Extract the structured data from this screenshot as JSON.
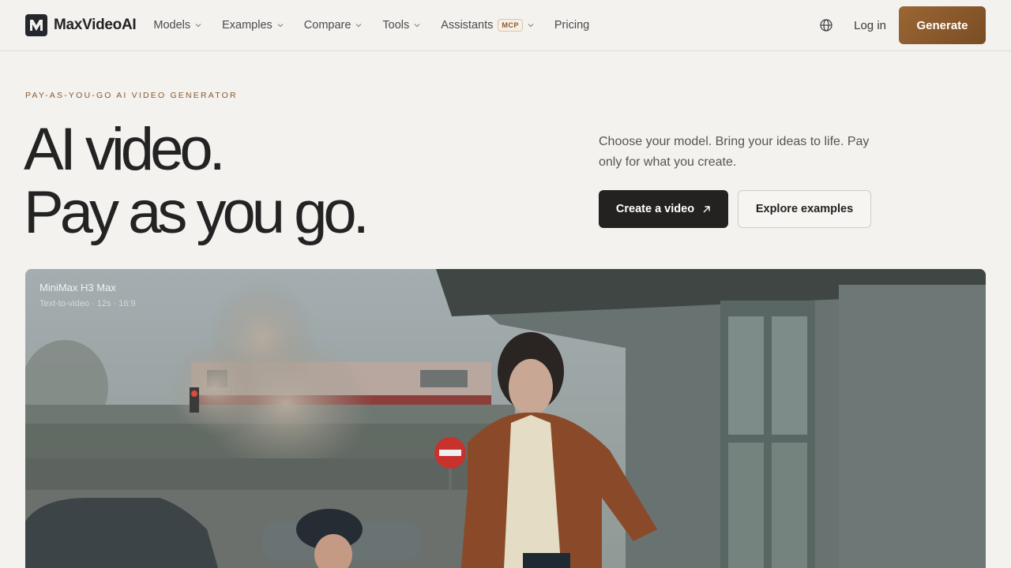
{
  "brand": {
    "name": "MaxVideoAI",
    "accent": "#8a5a2b"
  },
  "nav": {
    "items": [
      {
        "label": "Models",
        "has_dropdown": true
      },
      {
        "label": "Examples",
        "has_dropdown": true
      },
      {
        "label": "Compare",
        "has_dropdown": true
      },
      {
        "label": "Tools",
        "has_dropdown": true
      },
      {
        "label": "Assistants",
        "badge": "MCP",
        "has_dropdown": true
      },
      {
        "label": "Pricing",
        "has_dropdown": false
      }
    ],
    "globe_icon": "globe-icon",
    "login_label": "Log in",
    "generate_label": "Generate"
  },
  "hero": {
    "eyebrow": "PAY-AS-YOU-GO AI VIDEO GENERATOR",
    "headline_line1": "AI video.",
    "headline_line2": "Pay as you go.",
    "subtitle": "Choose your model. Bring your ideas to life. Pay only for what you create.",
    "primary_cta": "Create a video",
    "primary_cta_icon": "arrow-up-right-icon",
    "secondary_cta": "Explore examples"
  },
  "video": {
    "title": "MiniMax H3 Max",
    "meta": "Text-to-video · 12s · 16:9"
  }
}
